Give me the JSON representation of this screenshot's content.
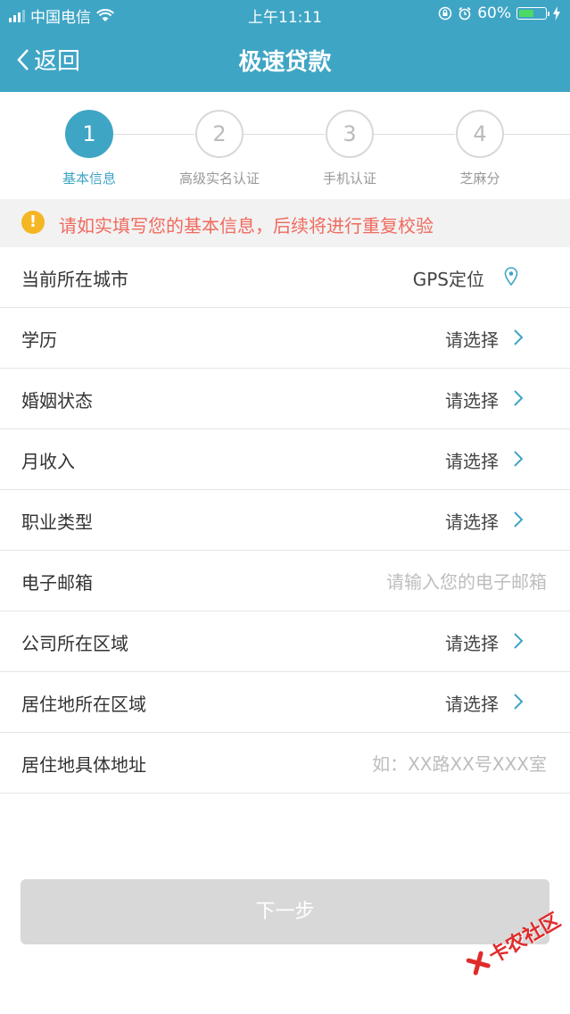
{
  "status_bar": {
    "carrier": "中国电信",
    "time": "上午11:11",
    "battery_percent": "60%",
    "battery_level": 0.6,
    "icons": [
      "signal-icon",
      "wifi-icon",
      "rotation-lock-icon",
      "alarm-icon",
      "battery-icon",
      "charging-icon"
    ]
  },
  "nav": {
    "back_label": "返回",
    "title": "极速贷款"
  },
  "steps": [
    {
      "number": "1",
      "label": "基本信息",
      "active": true
    },
    {
      "number": "2",
      "label": "高级实名认证",
      "active": false
    },
    {
      "number": "3",
      "label": "手机认证",
      "active": false
    },
    {
      "number": "4",
      "label": "芝麻分",
      "active": false
    }
  ],
  "notice": {
    "icon": "!",
    "text": "请如实填写您的基本信息，后续将进行重复校验"
  },
  "form": {
    "city": {
      "label": "当前所在城市",
      "value": "GPS定位"
    },
    "education": {
      "label": "学历",
      "value": "请选择"
    },
    "marital": {
      "label": "婚姻状态",
      "value": "请选择"
    },
    "income": {
      "label": "月收入",
      "value": "请选择"
    },
    "job_type": {
      "label": "职业类型",
      "value": "请选择"
    },
    "email": {
      "label": "电子邮箱",
      "placeholder": "请输入您的电子邮箱"
    },
    "company_area": {
      "label": "公司所在区域",
      "value": "请选择"
    },
    "residence_area": {
      "label": "居住地所在区域",
      "value": "请选择"
    },
    "residence_address": {
      "label": "居住地具体地址",
      "placeholder": "如：XX路XX号XXX室"
    }
  },
  "next_button": "下一步",
  "watermark": "卡农社区",
  "colors": {
    "primary": "#3fa5c5",
    "warning_text": "#f06a5e",
    "warning_icon": "#f5b623",
    "disabled_button": "#d8d8d8"
  }
}
